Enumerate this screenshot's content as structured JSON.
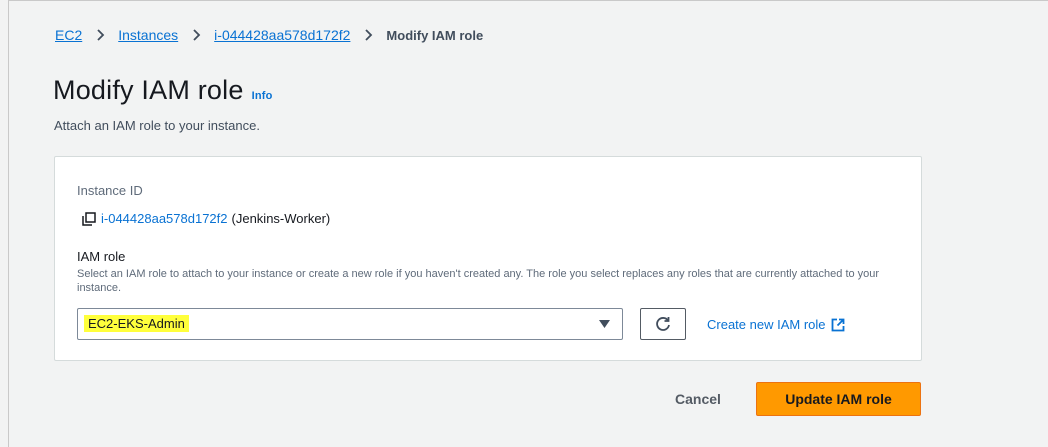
{
  "breadcrumb": {
    "items": [
      "EC2",
      "Instances",
      "i-044428aa578d172f2"
    ],
    "current": "Modify IAM role"
  },
  "header": {
    "title": "Modify IAM role",
    "info_label": "Info",
    "description": "Attach an IAM role to your instance."
  },
  "instance": {
    "label": "Instance ID",
    "id": "i-044428aa578d172f2",
    "name": "(Jenkins-Worker)"
  },
  "iam_role": {
    "label": "IAM role",
    "description": "Select an IAM role to attach to your instance or create a new role if you haven't created any. The role you select replaces any roles that are currently attached to your instance.",
    "selected": "EC2-EKS-Admin",
    "create_link": "Create new IAM role"
  },
  "actions": {
    "cancel_label": "Cancel",
    "submit_label": "Update IAM role"
  },
  "colors": {
    "link": "#0972d3",
    "primary_button": "#ff9900",
    "highlight": "#ffff3c",
    "background": "#f2f3f3"
  },
  "icons": {
    "separator": "chevron-right-icon",
    "copy": "copy-icon",
    "dropdown": "caret-down-icon",
    "refresh": "refresh-icon",
    "external": "external-link-icon"
  }
}
